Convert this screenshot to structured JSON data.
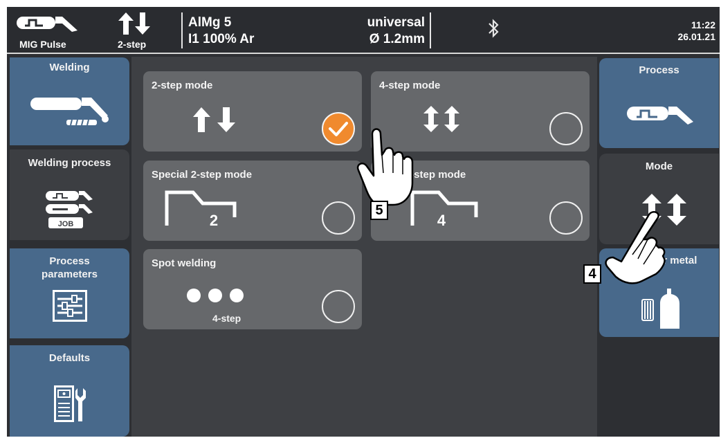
{
  "status_bar": {
    "process_name": "MIG Pulse",
    "mode_name": "2-step",
    "material": "AlMg 5",
    "gas": "I1 100% Ar",
    "characteristic": "universal",
    "wire_diameter": "Ø 1.2mm",
    "time": "11:22",
    "date": "26.01.21"
  },
  "left_nav": {
    "items": [
      {
        "label": "Welding",
        "icon": "welding-torch-icon",
        "state": "active"
      },
      {
        "label": "Welding process",
        "icon": "job-process-icon",
        "state": "inactive"
      },
      {
        "label": "Process parameters",
        "icon": "parameter-sliders-icon",
        "state": "active"
      },
      {
        "label": "Defaults",
        "icon": "machine-defaults-icon",
        "state": "active"
      }
    ]
  },
  "right_nav": {
    "items": [
      {
        "label": "Process",
        "icon": "mig-pulse-icon",
        "state": "active"
      },
      {
        "label": "Mode",
        "icon": "4-step-arrows-icon",
        "state": "selected"
      },
      {
        "label": "ller metal",
        "icon": "filler-metal-icon",
        "state": "active"
      }
    ]
  },
  "modes": [
    {
      "label": "2-step mode",
      "icon": "2-step-arrows-icon",
      "selected": true
    },
    {
      "label": "4-step mode",
      "icon": "4-step-arrows-icon",
      "selected": false
    },
    {
      "label": "Special 2-step mode",
      "icon": "special-2-step-profile-icon",
      "digit": "2",
      "selected": false
    },
    {
      "label": "ial 4-step mode",
      "icon": "special-4-step-profile-icon",
      "digit": "4",
      "selected": false
    },
    {
      "label": "Spot welding",
      "icon": "spot-dots-icon",
      "sublabel": "4-step",
      "selected": false
    }
  ],
  "callouts": {
    "step_5": "5",
    "step_4": "4"
  },
  "colors": {
    "accent_blue": "#48698b",
    "selected_orange": "#f08a2e",
    "card_gray": "#66686b",
    "background": "#2d2f33"
  }
}
